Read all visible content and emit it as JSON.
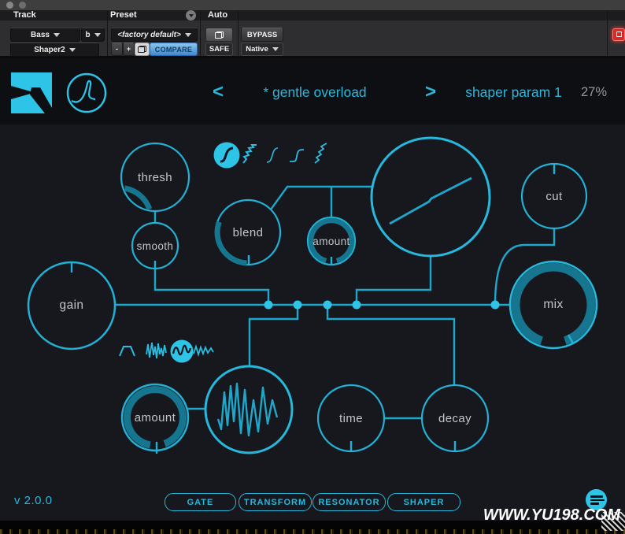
{
  "window": {
    "track": {
      "label": "Track",
      "channel": "Bass",
      "bus": "b",
      "plugin_slot": "Shaper2"
    },
    "preset": {
      "label": "Preset",
      "value": "<factory default>",
      "minus": "-",
      "plus": "+",
      "compare": "COMPARE"
    },
    "auto": {
      "label": "Auto",
      "safe": "SAFE"
    },
    "right": {
      "bypass": "BYPASS",
      "mode": "Native"
    }
  },
  "header": {
    "prev_arrow": "<",
    "next_arrow": ">",
    "preset_name": "* gentle overload",
    "param_label": "shaper param 1",
    "param_value": "27%"
  },
  "knobs": {
    "thresh": "thresh",
    "smooth": "smooth",
    "blend": "blend",
    "amount_drive": "amount",
    "cut": "cut",
    "gain": "gain",
    "mix": "mix",
    "amount_mod": "amount",
    "time": "time",
    "decay": "decay"
  },
  "curve_icons": {
    "selected": 0,
    "names": [
      "soft-sigmoid",
      "jagged-sigmoid",
      "smooth-sigmoid",
      "step-sigmoid",
      "staircase"
    ]
  },
  "wave_icons": {
    "selected": 2,
    "names": [
      "trapezoid",
      "dense-noise",
      "smooth-noise",
      "zigzag"
    ]
  },
  "footer": {
    "version": "v 2.0.0",
    "tabs": [
      {
        "label": "GATE"
      },
      {
        "label": "TRANSFORM"
      },
      {
        "label": "RESONATOR"
      },
      {
        "label": "SHAPER"
      }
    ]
  },
  "watermark": "WWW.YU198.COM",
  "colors": {
    "accent": "#2dc4e8",
    "line": "#1ea7cb",
    "value_arc": "#16768f",
    "text_cyan": "#2ab7dc"
  }
}
